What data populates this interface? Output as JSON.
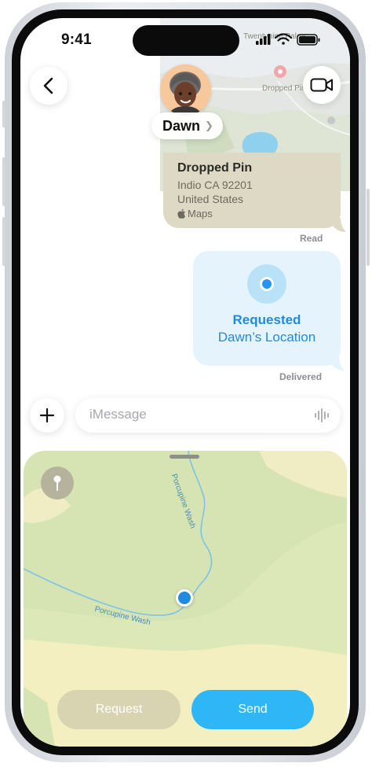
{
  "status_bar": {
    "time": "9:41"
  },
  "contact": {
    "name": "Dawn"
  },
  "map_preview": {
    "place_top": "Twentynine Palms",
    "place_pin": "Dropped Pin"
  },
  "pin_card": {
    "title": "Dropped Pin",
    "line1": "Indio CA 92201",
    "line2": "United States",
    "source": "Maps"
  },
  "read_receipt": "Read",
  "request_bubble": {
    "line1": "Requested",
    "line2": "Dawn’s Location"
  },
  "delivered_receipt": "Delivered",
  "composer": {
    "placeholder": "iMessage"
  },
  "map_sheet": {
    "wash_label_1": "Porcupine Wash",
    "wash_label_2": "Porcupine Wash"
  },
  "actions": {
    "request": "Request",
    "send": "Send"
  },
  "colors": {
    "accent": "#1f8be0",
    "send": "#2fb6f6",
    "bubble": "#e5f4fc"
  }
}
